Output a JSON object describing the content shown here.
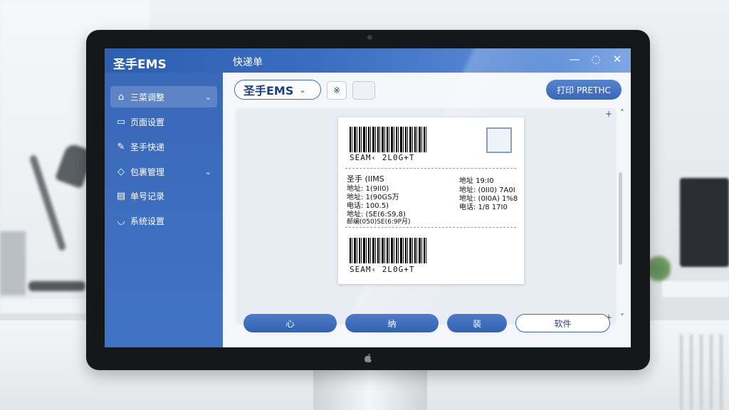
{
  "app": {
    "title": "圣手EMS",
    "window_title": "快递单",
    "controls": [
      "—",
      "◌",
      "✕"
    ]
  },
  "sidebar": {
    "items": [
      {
        "label": "三菜调整",
        "icon": "home-icon",
        "chevron": "⌄",
        "active": true
      },
      {
        "label": "页面设置",
        "icon": "document-icon"
      },
      {
        "label": "圣手快递",
        "icon": "edit-icon"
      },
      {
        "label": "包裹管理",
        "icon": "package-icon",
        "chevron": "⌄"
      },
      {
        "label": "单号记录",
        "icon": "list-icon"
      },
      {
        "label": "系统设置",
        "icon": "shield-icon"
      }
    ]
  },
  "toolbar": {
    "select_value": "圣手EMS",
    "select_chevron": "⌄",
    "tool1": "※",
    "print_label": "打印 PRETHC"
  },
  "label": {
    "barcode_top_text": "SEAM‹ 2L0G+T",
    "barcode_bottom_text": "SEAM‹ 2L0G+T",
    "sender_lines": [
      "圣手 (IIMS",
      "地址: 1(9II0)",
      "地址: 1(90GS万",
      "电话: 100.5)",
      "地址: (SE(6:S9,8)",
      "邮编(050)SE(6:9P月)"
    ],
    "right_lines": [
      "地址    19:I0",
      "地址: (0II0)  7A0I",
      "地址: (0I0A)   1%8",
      "电话: 1/8  17I0"
    ]
  },
  "bottom_buttons": [
    "心",
    "纳",
    "装",
    "软件"
  ],
  "colors": {
    "accent": "#3a68b8",
    "title_gradient_end": "#7fa6e3"
  }
}
